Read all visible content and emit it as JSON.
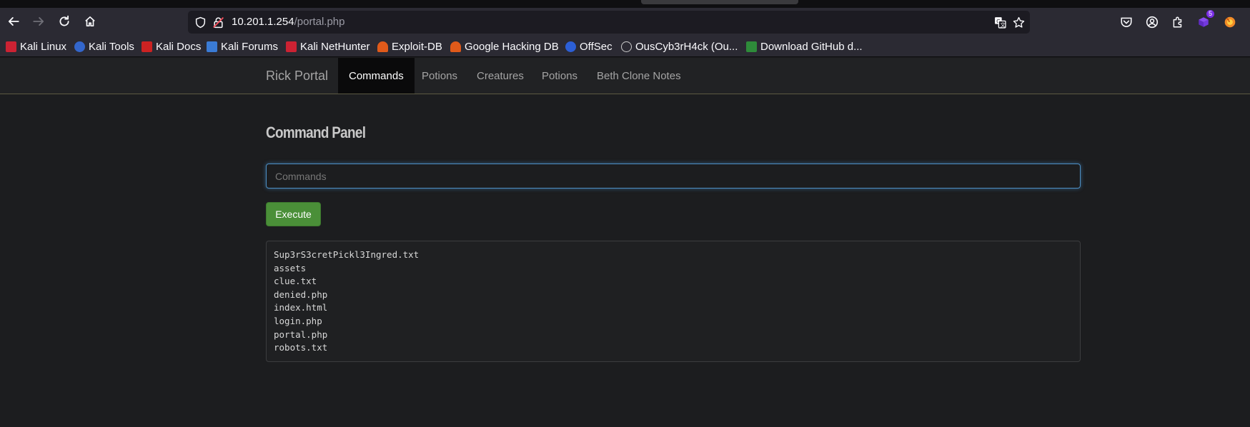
{
  "browser": {
    "url_host": "10.201.1.254",
    "url_path": "/portal.php",
    "extensions_badge": "5",
    "icons": [
      "back-icon",
      "forward-icon",
      "reload-icon",
      "home-icon",
      "shield-icon",
      "lock-warning-icon",
      "translate-icon",
      "star-icon",
      "pocket-icon",
      "account-icon",
      "extensions-icon",
      "extension-badge-icon",
      "firefox-view-icon"
    ]
  },
  "bookmarks": [
    {
      "label": "Kali Linux",
      "color": "#cc2233"
    },
    {
      "label": "Kali Tools",
      "color": "#3366cc"
    },
    {
      "label": "Kali Docs",
      "color": "#cc2222"
    },
    {
      "label": "Kali Forums",
      "color": "#3a7bd5"
    },
    {
      "label": "Kali NetHunter",
      "color": "#cc2233"
    },
    {
      "label": "Exploit-DB",
      "color": "#e05a1a"
    },
    {
      "label": "Google Hacking DB",
      "color": "#e05a1a"
    },
    {
      "label": "OffSec",
      "color": "#2c5fd6"
    },
    {
      "label": "OusCyb3rH4ck (Ou...",
      "color": "#cccccc"
    },
    {
      "label": "Download GitHub d...",
      "color": "#2e8b3a"
    }
  ],
  "site": {
    "brand": "Rick Portal",
    "nav": [
      {
        "label": "Commands",
        "active": true
      },
      {
        "label": "Potions",
        "active": false
      },
      {
        "label": "Creatures",
        "active": false
      },
      {
        "label": "Potions",
        "active": false
      },
      {
        "label": "Beth Clone Notes",
        "active": false
      }
    ]
  },
  "panel": {
    "title": "Command Panel",
    "input_placeholder": "Commands",
    "input_value": "",
    "execute_label": "Execute",
    "output_lines": [
      "Sup3rS3cretPickl3Ingred.txt",
      "assets",
      "clue.txt",
      "denied.php",
      "index.html",
      "login.php",
      "portal.php",
      "robots.txt"
    ]
  },
  "colors": {
    "accent_green": "#4a8f38",
    "focus_blue": "#4d8fc4",
    "nav_active_bg": "#0a0a0b"
  }
}
